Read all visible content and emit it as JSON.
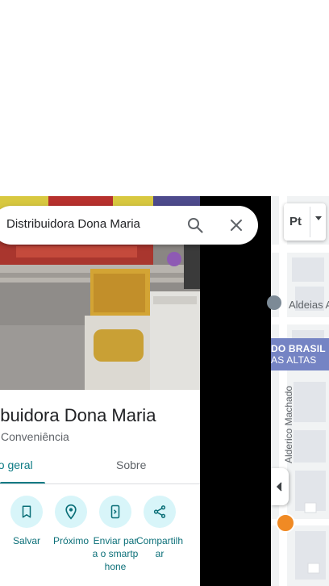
{
  "search": {
    "query": "Distribuidora Dona Maria"
  },
  "place": {
    "title": "ribuidora Dona Maria",
    "category": "Conveniência"
  },
  "tabs": [
    {
      "label": "ão geral",
      "active": true
    },
    {
      "label": "Sobre",
      "active": false
    }
  ],
  "actions": [
    {
      "label": "Salvar",
      "icon": "bookmark-icon"
    },
    {
      "label": "Próximo",
      "icon": "nearby-icon"
    },
    {
      "label": "Enviar para o smartphone",
      "icon": "send-to-phone-icon"
    },
    {
      "label": "Compartilhar",
      "icon": "share-icon"
    }
  ],
  "map": {
    "layer_button": "Pt",
    "labels": {
      "aldeias": "Aldeias A",
      "brasil": "DO BRASIL",
      "altas": "AS ALTAS",
      "street": "Alderico Machado"
    }
  },
  "colors": {
    "accent": "#0b7a83",
    "action_bg": "#d8f5f9",
    "map_bg": "#f1f3f4",
    "highlight_block": "#7584c4",
    "poi_food": "#f08a24"
  }
}
